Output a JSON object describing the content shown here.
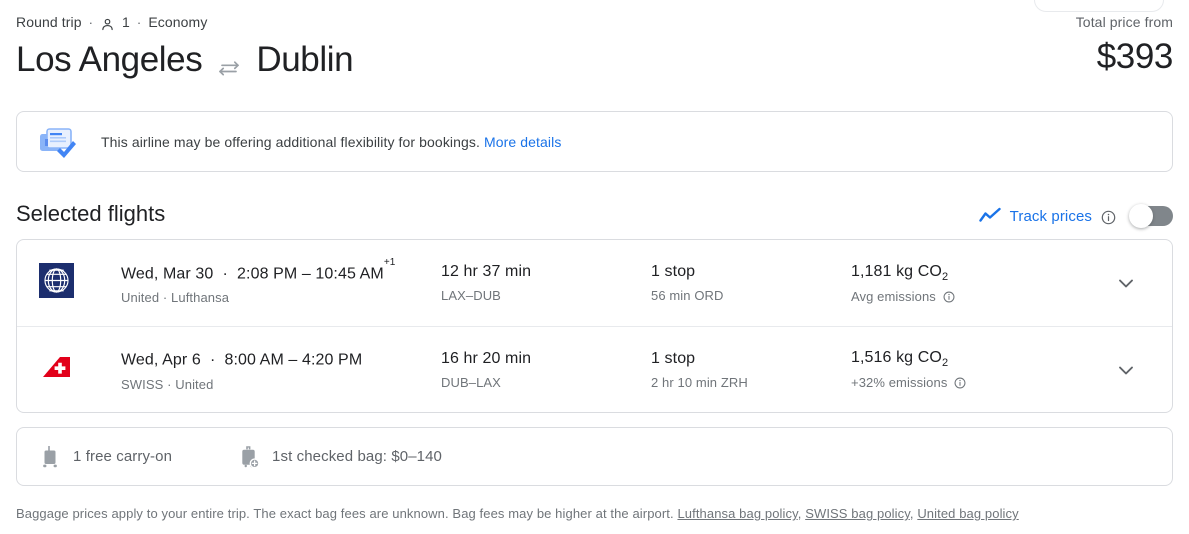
{
  "header": {
    "trip_type": "Round trip",
    "separator": "·",
    "passengers": "1",
    "cabin_class": "Economy",
    "origin": "Los Angeles",
    "destination": "Dublin",
    "swap_icon": "swap-arrows-icon",
    "person_icon": "person-icon",
    "price_label": "Total price from",
    "price_value": "$393"
  },
  "banner": {
    "icon": "flexible-ticket-icon",
    "text": "This airline may be offering additional flexibility for bookings.",
    "link_label": "More details"
  },
  "selected_flights": {
    "title": "Selected flights",
    "track_prices": {
      "icon": "trending-up-icon",
      "label": "Track prices",
      "info_icon": "info-icon",
      "toggle_state": "off"
    },
    "rows": [
      {
        "airline_logo": "united-airlines-logo",
        "date": "Wed, Mar 30",
        "separator": "·",
        "times": "2:08 PM – 10:45 AM",
        "day_offset": "+1",
        "operators": "United · Lufthansa",
        "duration": "12 hr 37 min",
        "route": "LAX–DUB",
        "stops": "1 stop",
        "layover": "56 min ORD",
        "emissions_value": "1,181 kg CO",
        "emissions_sub": "2",
        "emissions_note": "Avg emissions",
        "emissions_info_icon": "info-icon",
        "expand_icon": "chevron-down-icon"
      },
      {
        "airline_logo": "swiss-airlines-logo",
        "date": "Wed, Apr 6",
        "separator": "·",
        "times": "8:00 AM – 4:20 PM",
        "day_offset": "",
        "operators": "SWISS · United",
        "duration": "16 hr 20 min",
        "route": "DUB–LAX",
        "stops": "1 stop",
        "layover": "2 hr 10 min ZRH",
        "emissions_value": "1,516 kg CO",
        "emissions_sub": "2",
        "emissions_note": "+32% emissions",
        "emissions_info_icon": "info-icon",
        "expand_icon": "chevron-down-icon"
      }
    ]
  },
  "bags": {
    "items": [
      {
        "icon": "carry-on-bag-icon",
        "label": "1 free carry-on"
      },
      {
        "icon": "checked-bag-add-icon",
        "label": "1st checked bag: $0–140"
      }
    ]
  },
  "footer": {
    "text": "Baggage prices apply to your entire trip. The exact bag fees are unknown. Bag fees may be higher at the airport.",
    "links": [
      {
        "label": "Lufthansa bag policy",
        "trailing": ","
      },
      {
        "label": "SWISS bag policy",
        "trailing": ","
      },
      {
        "label": "United bag policy",
        "trailing": ""
      }
    ]
  },
  "colors": {
    "accent_blue": "#1a73e8",
    "text_primary": "#202124",
    "text_secondary": "#70757a",
    "border": "#dadce0",
    "united_navy": "#1c2e6e",
    "swiss_red": "#e2001a"
  }
}
